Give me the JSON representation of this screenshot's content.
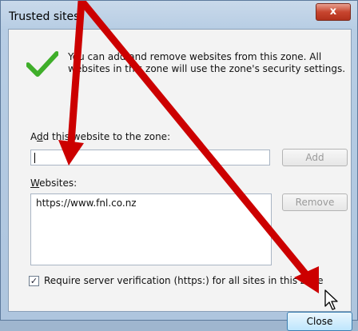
{
  "window": {
    "title": "Trusted sites",
    "close_glyph": "x"
  },
  "info": {
    "text": "You can add and remove websites from this zone. All websites in this zone will use the zone's security settings."
  },
  "add_section": {
    "label_pre": "A",
    "label_access": "d",
    "label_post": "d this website to the zone:",
    "input_value": "",
    "add_button": "Add"
  },
  "websites": {
    "label_access": "W",
    "label_post": "ebsites:",
    "items": [
      "https://www.fnl.co.nz"
    ],
    "remove_button": "Remove"
  },
  "https_option": {
    "checked": true,
    "label": "Require server verification (https:) for all sites in this zone"
  },
  "footer": {
    "close_button": "Close"
  },
  "colors": {
    "annotation_arrow": "#cc0000",
    "checkmark": "#3fae2a"
  },
  "icons": [
    "checkmark-icon",
    "close-icon",
    "mouse-cursor-icon",
    "checkbox-check-icon"
  ]
}
